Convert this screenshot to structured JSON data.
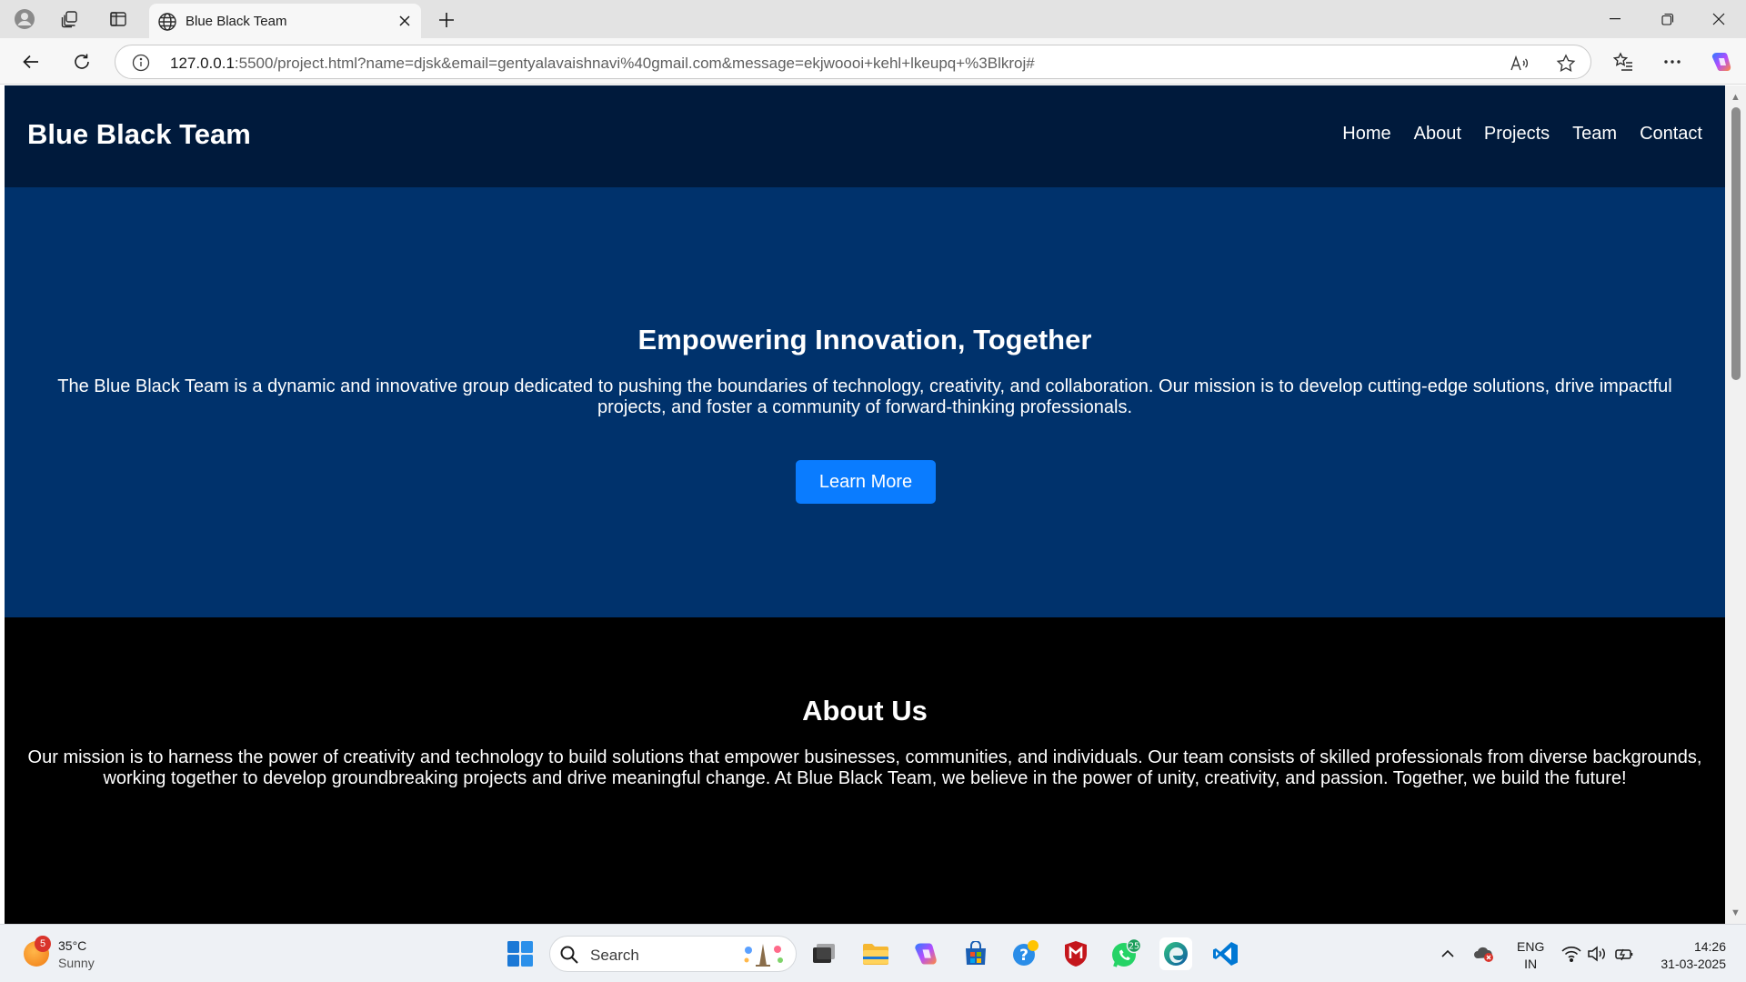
{
  "browser": {
    "tab_title": "Blue Black Team",
    "url_host": "127.0.0.1",
    "url_rest": ":5500/project.html?name=djsk&email=gentyalavaishnavi%40gmail.com&message=ekjwoooi+kehl+lkeupq+%3Blkroj#"
  },
  "site": {
    "brand": "Blue Black Team",
    "nav": [
      "Home",
      "About",
      "Projects",
      "Team",
      "Contact"
    ]
  },
  "hero": {
    "title": "Empowering Innovation, Together",
    "text": "The Blue Black Team is a dynamic and innovative group dedicated to pushing the boundaries of technology, creativity, and collaboration. Our mission is to develop cutting-edge solutions, drive impactful projects, and foster a community of forward-thinking professionals.",
    "button": "Learn More"
  },
  "about": {
    "title": "About Us",
    "text": "Our mission is to harness the power of creativity and technology to build solutions that empower businesses, communities, and individuals. Our team consists of skilled professionals from diverse backgrounds, working together to develop groundbreaking projects and drive meaningful change. At Blue Black Team, we believe in the power of unity, creativity, and passion. Together, we build the future!"
  },
  "taskbar": {
    "weather_badge": "5",
    "weather_temp": "35°C",
    "weather_cond": "Sunny",
    "search_placeholder": "Search",
    "whatsapp_badge": "25",
    "lang_top": "ENG",
    "lang_bottom": "IN",
    "time": "14:26",
    "date": "31-03-2025"
  },
  "colors": {
    "header_bg": "#001a3c",
    "hero_bg": "#00326c",
    "about_bg": "#000000",
    "button_bg": "#0a7cff"
  }
}
